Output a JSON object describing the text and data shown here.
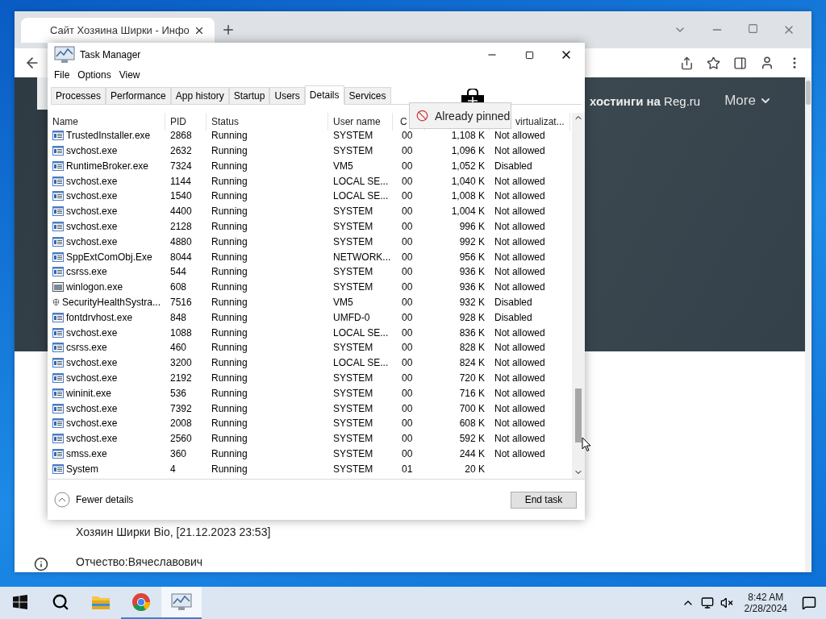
{
  "browser": {
    "tab": {
      "title": "Сайт Хозяина Ширки - Инфо"
    },
    "header": {
      "nav": "**хостинги на** Reg.ru",
      "more": "More"
    },
    "content": {
      "lines": [
        "Хозяин Ширки Bio, [21.12.2023 23:53]",
        "Отчество:Вячеславович"
      ]
    }
  },
  "task_manager": {
    "title": "Task Manager",
    "menu": [
      "File",
      "Options",
      "View"
    ],
    "tabs": [
      {
        "label": "Processes",
        "selected": false
      },
      {
        "label": "Performance",
        "selected": false
      },
      {
        "label": "App history",
        "selected": false
      },
      {
        "label": "Startup",
        "selected": false
      },
      {
        "label": "Users",
        "selected": false
      },
      {
        "label": "Details",
        "selected": true
      },
      {
        "label": "Services",
        "selected": false
      }
    ],
    "columns": [
      {
        "label": "Name"
      },
      {
        "label": "PID"
      },
      {
        "label": "Status"
      },
      {
        "label": "User name"
      },
      {
        "label": "C"
      },
      {},
      {
        "label": "virtualizat..."
      }
    ],
    "rows": [
      {
        "kind": "app",
        "cells": [
          "TrustedInstaller.exe",
          "2868",
          "Running",
          "SYSTEM",
          "00",
          "1,108 K",
          "Not allowed"
        ]
      },
      {
        "kind": "app",
        "cells": [
          "svchost.exe",
          "2632",
          "Running",
          "SYSTEM",
          "00",
          "1,096 K",
          "Not allowed"
        ]
      },
      {
        "kind": "app",
        "cells": [
          "RuntimeBroker.exe",
          "7324",
          "Running",
          "VM5",
          "00",
          "1,052 K",
          "Disabled"
        ]
      },
      {
        "kind": "app",
        "cells": [
          "svchost.exe",
          "1144",
          "Running",
          "LOCAL SE...",
          "00",
          "1,040 K",
          "Not allowed"
        ]
      },
      {
        "kind": "app",
        "cells": [
          "svchost.exe",
          "1540",
          "Running",
          "LOCAL SE...",
          "00",
          "1,008 K",
          "Not allowed"
        ]
      },
      {
        "kind": "app",
        "cells": [
          "svchost.exe",
          "4400",
          "Running",
          "SYSTEM",
          "00",
          "1,004 K",
          "Not allowed"
        ]
      },
      {
        "kind": "app",
        "cells": [
          "svchost.exe",
          "2128",
          "Running",
          "SYSTEM",
          "00",
          "996 K",
          "Not allowed"
        ]
      },
      {
        "kind": "app",
        "cells": [
          "svchost.exe",
          "4880",
          "Running",
          "SYSTEM",
          "00",
          "992 K",
          "Not allowed"
        ]
      },
      {
        "kind": "app",
        "cells": [
          "SppExtComObj.Exe",
          "8044",
          "Running",
          "NETWORK...",
          "00",
          "956 K",
          "Not allowed"
        ]
      },
      {
        "kind": "app",
        "cells": [
          "csrss.exe",
          "544",
          "Running",
          "SYSTEM",
          "00",
          "936 K",
          "Not allowed"
        ]
      },
      {
        "kind": "window",
        "cells": [
          "winlogon.exe",
          "608",
          "Running",
          "SYSTEM",
          "00",
          "936 K",
          "Not allowed"
        ]
      },
      {
        "kind": "shield",
        "cells": [
          "SecurityHealthSystra...",
          "7516",
          "Running",
          "VM5",
          "00",
          "932 K",
          "Disabled"
        ]
      },
      {
        "kind": "app",
        "cells": [
          "fontdrvhost.exe",
          "848",
          "Running",
          "UMFD-0",
          "00",
          "928 K",
          "Disabled"
        ]
      },
      {
        "kind": "app",
        "cells": [
          "svchost.exe",
          "1088",
          "Running",
          "LOCAL SE...",
          "00",
          "836 K",
          "Not allowed"
        ]
      },
      {
        "kind": "app",
        "cells": [
          "csrss.exe",
          "460",
          "Running",
          "SYSTEM",
          "00",
          "828 K",
          "Not allowed"
        ]
      },
      {
        "kind": "app",
        "cells": [
          "svchost.exe",
          "3200",
          "Running",
          "LOCAL SE...",
          "00",
          "824 K",
          "Not allowed"
        ]
      },
      {
        "kind": "app",
        "cells": [
          "svchost.exe",
          "2192",
          "Running",
          "SYSTEM",
          "00",
          "720 K",
          "Not allowed"
        ]
      },
      {
        "kind": "app",
        "cells": [
          "wininit.exe",
          "536",
          "Running",
          "SYSTEM",
          "00",
          "716 K",
          "Not allowed"
        ]
      },
      {
        "kind": "app",
        "cells": [
          "svchost.exe",
          "7392",
          "Running",
          "SYSTEM",
          "00",
          "700 K",
          "Not allowed"
        ]
      },
      {
        "kind": "app",
        "cells": [
          "svchost.exe",
          "2008",
          "Running",
          "SYSTEM",
          "00",
          "608 K",
          "Not allowed"
        ]
      },
      {
        "kind": "app",
        "cells": [
          "svchost.exe",
          "2560",
          "Running",
          "SYSTEM",
          "00",
          "592 K",
          "Not allowed"
        ]
      },
      {
        "kind": "app",
        "cells": [
          "smss.exe",
          "360",
          "Running",
          "SYSTEM",
          "00",
          "244 K",
          "Not allowed"
        ]
      },
      {
        "kind": "app",
        "cells": [
          "System",
          "4",
          "Running",
          "SYSTEM",
          "01",
          "20 K"
        ]
      }
    ],
    "fewer_details": "Fewer details",
    "end_task": "End task"
  },
  "tooltip": {
    "text": "Already pinned"
  },
  "taskbar": {
    "apps": [
      {
        "kind": "explorer",
        "running": false,
        "selected": false
      },
      {
        "kind": "chrome",
        "running": true,
        "selected": false
      },
      {
        "kind": "taskmgr",
        "running": true,
        "selected": true
      }
    ],
    "time": "8:42 AM",
    "date": "2/28/2024"
  }
}
